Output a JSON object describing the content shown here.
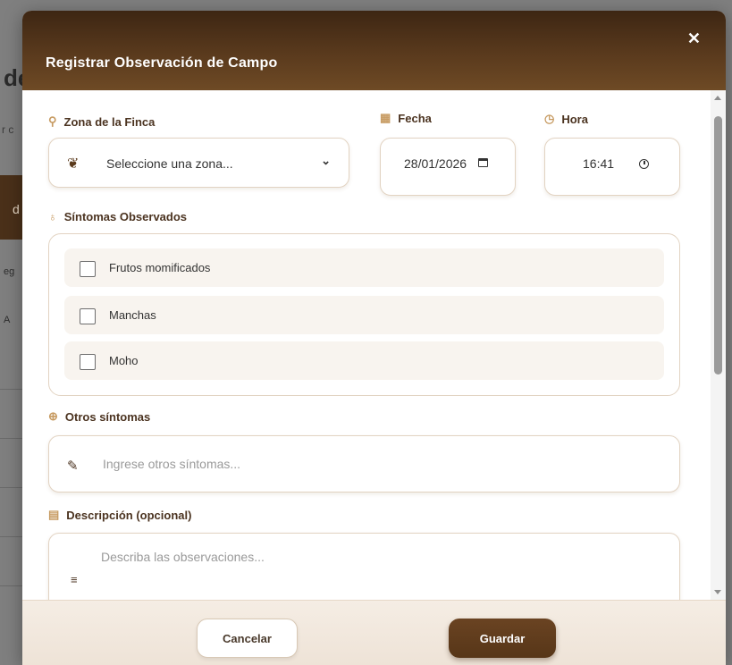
{
  "background": {
    "title_fragment": "de",
    "subtitle_fragment": "r c",
    "band_fragment": "d",
    "side_fragment_1": "eg",
    "side_fragment_2": "A"
  },
  "modal": {
    "title": "Registrar Observación de Campo",
    "close_symbol": "✕"
  },
  "zona": {
    "label": "Zona de la Finca",
    "icon": "map-pin-icon",
    "selected": "Seleccione una zona..."
  },
  "fecha": {
    "label": "Fecha",
    "icon": "calendar-icon",
    "value": "28/01/2026"
  },
  "hora": {
    "label": "Hora",
    "icon": "clock-icon",
    "value": "16:41"
  },
  "sintomas": {
    "label": "Síntomas Observados",
    "icon": "stethoscope-icon",
    "options": [
      {
        "label": "Frutos momificados",
        "checked": false
      },
      {
        "label": "Manchas",
        "checked": false
      },
      {
        "label": "Moho",
        "checked": false
      }
    ]
  },
  "otros": {
    "label": "Otros síntomas",
    "icon": "plus-circle-icon",
    "placeholder": "Ingrese otros síntomas..."
  },
  "descripcion": {
    "label": "Descripción (opcional)",
    "icon": "document-icon",
    "placeholder": "Describa las observaciones..."
  },
  "footer": {
    "cancel_label": "Cancelar",
    "save_label": "Guardar"
  },
  "colors": {
    "header_dark": "#3d2613",
    "accent_brown": "#5a3a1d",
    "label_brown": "#4b3320",
    "icon_tan": "#c79b62"
  }
}
